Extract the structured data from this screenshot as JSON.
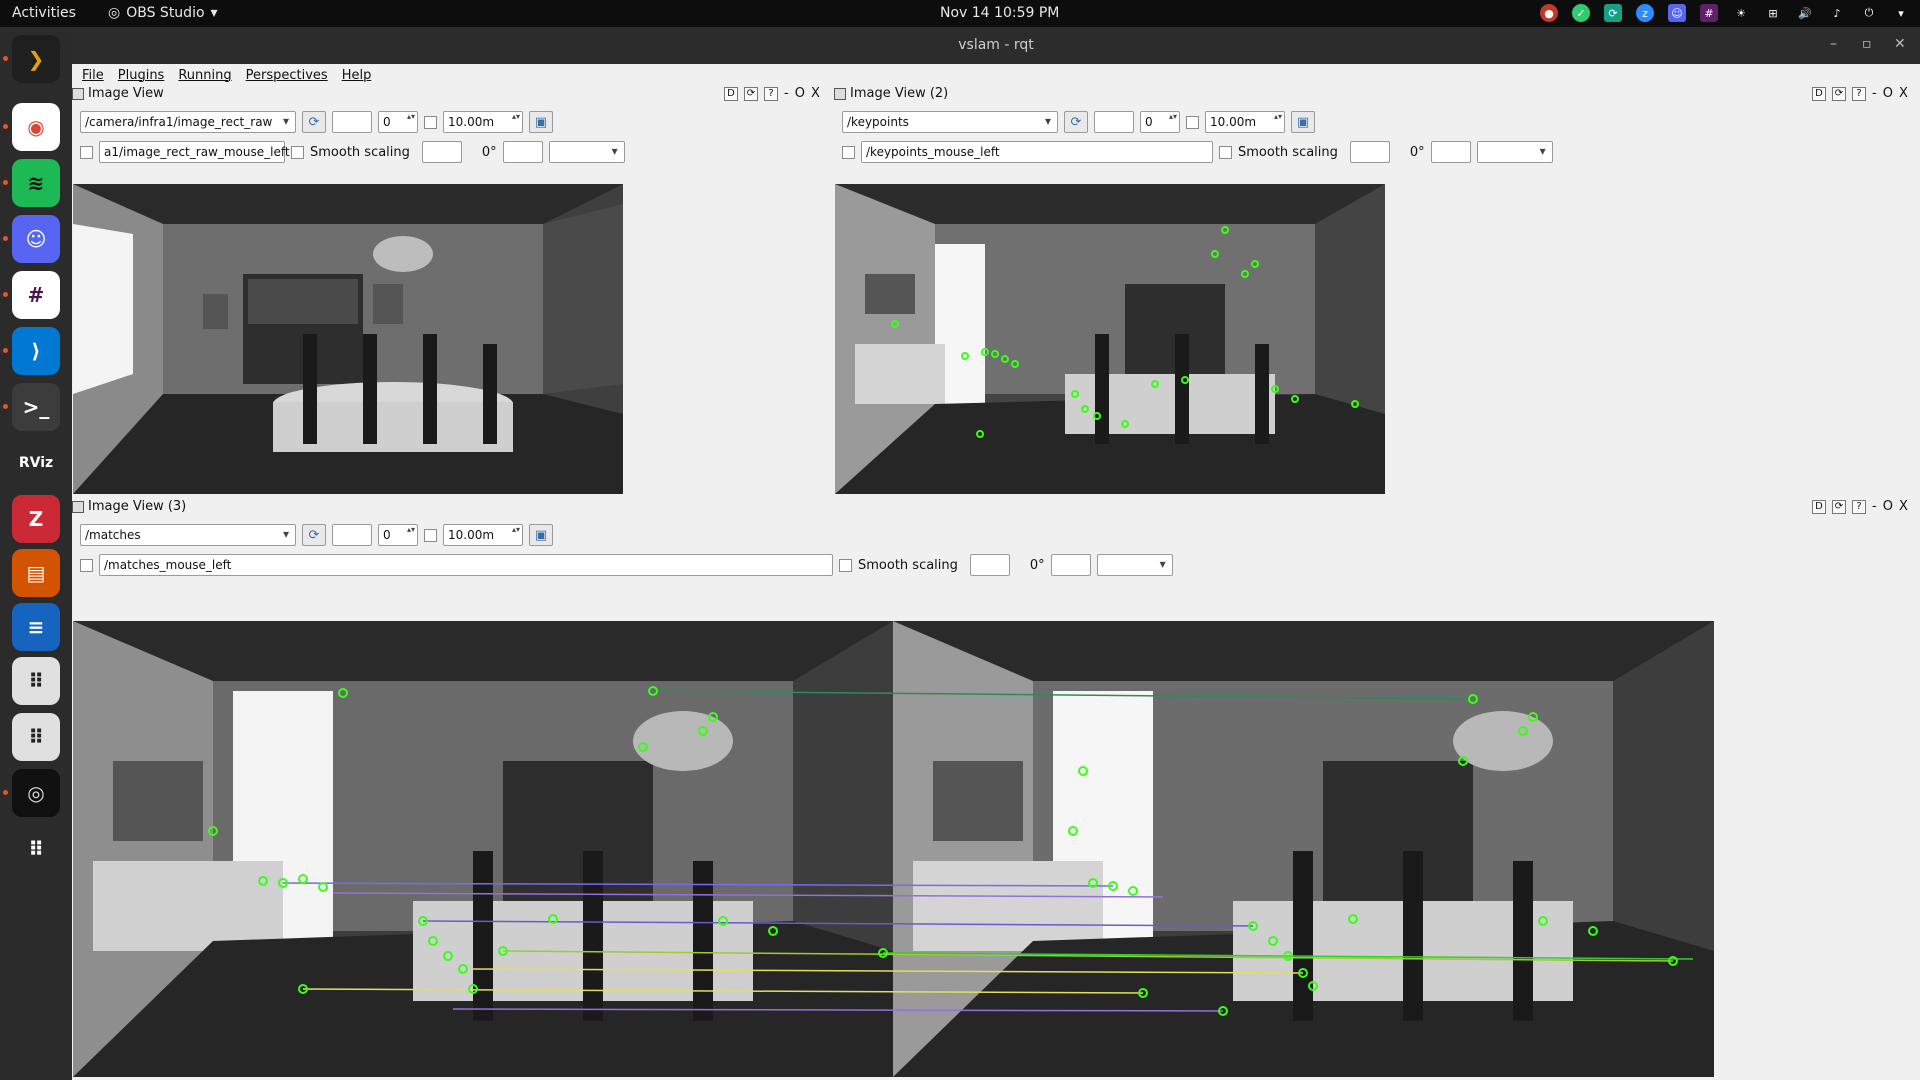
{
  "topbar": {
    "activities": "Activities",
    "app_name": "OBS Studio",
    "clock": "Nov 14  10:59 PM",
    "tray_icons": [
      "obs-tray-icon",
      "check-tray-icon",
      "sync-tray-icon",
      "zoom-tray-icon",
      "discord-tray-icon",
      "slack-tray-icon",
      "brightness-icon",
      "network-icon",
      "volume-icon",
      "mic-icon",
      "power-icon",
      "chevron-down-icon"
    ]
  },
  "dock": {
    "items": [
      {
        "name": "plex-icon",
        "glyph": "❯",
        "color": "#1f1f1f",
        "fg": "#e5a00d"
      },
      {
        "name": "chrome-icon",
        "glyph": "◉",
        "color": "#ffffff",
        "fg": "#db4437"
      },
      {
        "name": "spotify-icon",
        "glyph": "≋",
        "color": "#1db954",
        "fg": "#111"
      },
      {
        "name": "discord-icon",
        "glyph": "☺",
        "color": "#5865f2",
        "fg": "#fff"
      },
      {
        "name": "slack-icon",
        "glyph": "#",
        "color": "#ffffff",
        "fg": "#4a154b"
      },
      {
        "name": "vscode-icon",
        "glyph": "⟩",
        "color": "#0078d4",
        "fg": "#fff"
      },
      {
        "name": "terminal-icon",
        "glyph": ">_",
        "color": "#3c3c3c",
        "fg": "#fff"
      },
      {
        "name": "rviz-icon",
        "glyph": "RViz",
        "color": "#2b2b2b",
        "fg": "#fff"
      },
      {
        "name": "zotero-icon",
        "glyph": "Z",
        "color": "#cc2936",
        "fg": "#fff"
      },
      {
        "name": "impress-icon",
        "glyph": "▤",
        "color": "#d35400",
        "fg": "#fff"
      },
      {
        "name": "writer-icon",
        "glyph": "≡",
        "color": "#1565c0",
        "fg": "#fff"
      },
      {
        "name": "app-grid-a-icon",
        "glyph": "⠿",
        "color": "#e0e0e0",
        "fg": "#222"
      },
      {
        "name": "app-grid-b-icon",
        "glyph": "⠿",
        "color": "#e0e0e0",
        "fg": "#222"
      },
      {
        "name": "obs-icon",
        "glyph": "◎",
        "color": "#111111",
        "fg": "#ddd"
      },
      {
        "name": "show-apps-icon",
        "glyph": "⠿",
        "color": "#2b2b2b",
        "fg": "#fff"
      }
    ]
  },
  "window": {
    "title": "vslam - rqt",
    "menu": [
      "File",
      "Plugins",
      "Running",
      "Perspectives",
      "Help"
    ]
  },
  "panes": {
    "p1": {
      "title": "Image View",
      "topic": "/camera/infra1/image_rect_raw",
      "spin_value": "0",
      "max_range": "10.00m",
      "mouse_topic": "a1/image_rect_raw_mouse_left",
      "smooth_label": "Smooth scaling",
      "rotation": "0°"
    },
    "p2": {
      "title": "Image View (2)",
      "topic": "/keypoints",
      "spin_value": "0",
      "max_range": "10.00m",
      "mouse_topic": "/keypoints_mouse_left",
      "smooth_label": "Smooth scaling",
      "rotation": "0°"
    },
    "p3": {
      "title": "Image View (3)",
      "topic": "/matches",
      "spin_value": "0",
      "max_range": "10.00m",
      "mouse_topic": "/matches_mouse_left",
      "smooth_label": "Smooth scaling",
      "rotation": "0°"
    },
    "ctrl_labels": {
      "d": "D",
      "min": "-",
      "float": "O",
      "close": "X"
    }
  },
  "colors": {
    "keypoint": "#39ff14",
    "match_lines": [
      "#2e8b57",
      "#6a5acd",
      "#9acd32",
      "#e0e060",
      "#7b68ee"
    ]
  }
}
